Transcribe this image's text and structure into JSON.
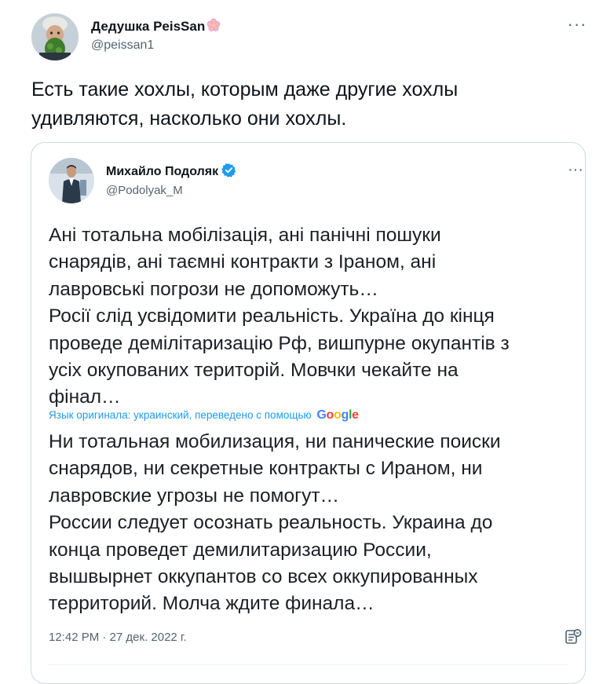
{
  "author": {
    "name": "Дедушка PeisSan",
    "handle": "@peissan1",
    "name_emoji_icon": "cherry-blossom-icon"
  },
  "tweet": {
    "text_lines": [
      "Есть такие хохлы, которым даже другие хохлы",
      "удивляются, насколько они хохлы."
    ]
  },
  "quoted_tweet": {
    "name": "Михайло Подоляк",
    "handle": "@Podolyak_M",
    "verified_icon": "verified-badge-icon",
    "original_lines": [
      "Ані тотальна мобілізація, ані панічні пошуки",
      "снарядів, ані таємні контракти з Іраном, ані",
      "лавровські погрози не допоможуть…",
      "Росії слід усвідомити реальність. Україна до кінця",
      "проведе демілітаризацію Рф, вишпурне окупантів з",
      "усіх окупованих територій. Мовчки чекайте на",
      "фінал…"
    ],
    "translation_note": "Язык оригинала: украинский, переведено с помощью",
    "translation_provider": "Google",
    "translated_lines": [
      "Ни тотальная мобилизация, ни панические поиски",
      "снарядов, ни секретные контракты с Ираном, ни",
      "лавровские угрозы не помогут…",
      "России следует осознать реальность. Украина до",
      "конца проведет демилитаризацию России,",
      "вышвырнет оккупантов со всех оккупированных",
      "территорий. Молча ждите финала…"
    ],
    "timestamp": "12:42 PM · 27 дек. 2022 г."
  },
  "colors": {
    "text": "#0f1419",
    "secondary": "#536471",
    "link": "#1d9bf0",
    "border": "#cfd9de",
    "verified": "#1d9bf0"
  }
}
